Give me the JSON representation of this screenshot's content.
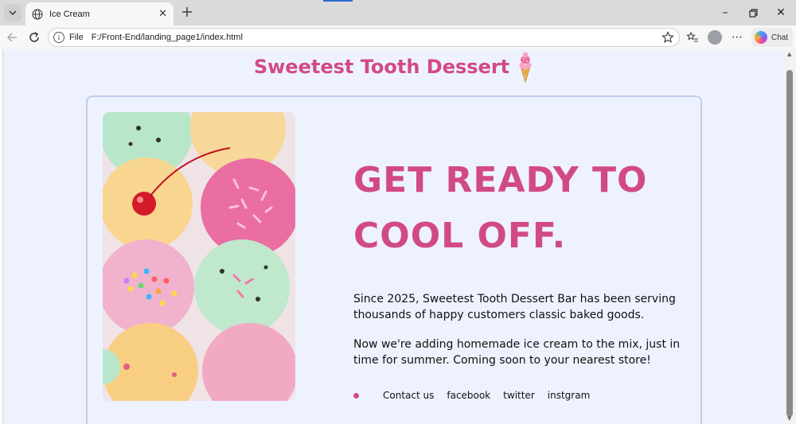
{
  "browser": {
    "tab_title": "Ice Cream",
    "address_scheme": "File",
    "address_url": "F:/Front-End/landing_page1/index.html",
    "copilot_label": "Chat"
  },
  "page": {
    "site_title": "Sweetest Tooth Dessert",
    "headline_line1": "GET READY TO",
    "headline_line2": "COOL OFF.",
    "paragraph1": "Since 2025, Sweetest Tooth Dessert Bar has been serving thousands of happy customers classic baked goods.",
    "paragraph2": "Now we're adding homemade ice cream to the mix, just in time for summer. Coming soon to your nearest store!",
    "links": [
      "Contact us",
      "facebook",
      "twitter",
      "instgram"
    ]
  },
  "colors": {
    "accent_pink": "#d14a85",
    "page_background": "#eef2ff",
    "card_border": "#c3cdea"
  },
  "icons": [
    "tab-list-icon",
    "globe-icon",
    "close-icon",
    "new-tab-icon",
    "back-icon",
    "reload-icon",
    "info-icon",
    "star-icon",
    "favorites-icon",
    "profile-icon",
    "more-icon",
    "copilot-icon",
    "ice-cream-cone-icon"
  ]
}
